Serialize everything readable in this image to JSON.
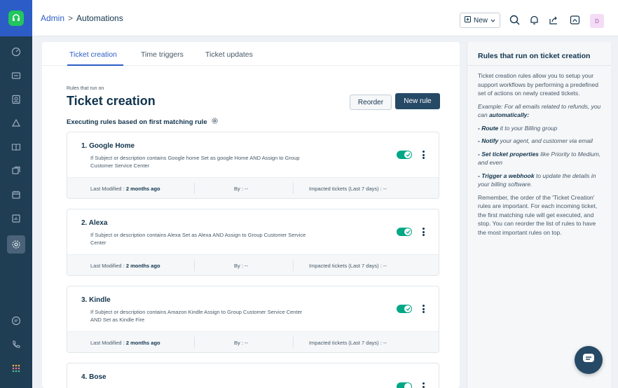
{
  "breadcrumb": {
    "admin": "Admin",
    "separator": ">",
    "current": "Automations"
  },
  "topbar": {
    "new_label": "New",
    "avatar_initial": "D",
    "icons": [
      "search-icon",
      "bell-icon",
      "share-icon",
      "copilot-icon"
    ]
  },
  "tabs": [
    "Ticket creation",
    "Time triggers",
    "Ticket updates"
  ],
  "page": {
    "pre_title": "Rules that run on",
    "title": "Ticket creation",
    "reorder_label": "Reorder",
    "new_rule_label": "New rule",
    "subtitle": "Executing rules based on first matching rule"
  },
  "rules": [
    {
      "name": "1. Google Home",
      "desc_line1": "If Subject or description contains Google home Set as google Home AND Assign to Group",
      "desc_line2": "Customer Service Center",
      "enabled": true,
      "last_modified_label": "Last Modified :",
      "last_modified_value": "2 months ago",
      "by": "By : --",
      "impacted": "Impacted tickets (Last 7 days) : --"
    },
    {
      "name": "2. Alexa",
      "desc_line1": "If Subject or description contains Alexa Set as Alexa AND Assign to Group Customer Service",
      "desc_line2": "Center",
      "enabled": true,
      "last_modified_label": "Last Modified :",
      "last_modified_value": "2 months ago",
      "by": "By : --",
      "impacted": "Impacted tickets (Last 7 days) : --"
    },
    {
      "name": "3. Kindle",
      "desc_line1": "If Subject or description contains Amazon Kindle Assign to Group Customer Service Center",
      "desc_line2": "AND Set as Kindle Fire",
      "enabled": true,
      "last_modified_label": "Last Modified :",
      "last_modified_value": "2 months ago",
      "by": "By : --",
      "impacted": "Impacted tickets (Last 7 days) : --"
    },
    {
      "name": "4. Bose",
      "enabled": true
    }
  ],
  "help": {
    "title": "Rules that run on ticket creation",
    "intro": "Ticket creation rules allow you to setup your support workflows by performing a predefined set of actions on newly created tickets.",
    "example_prefix": "Example: For all emails related to refunds, you can ",
    "example_bold": "automatically:",
    "b1_bold": "- Route",
    "b1_rest": " it to your Billing group",
    "b2_bold": "- Notify",
    "b2_rest": " your agent, and customer via email",
    "b3_bold": "- Set ticket properties",
    "b3_rest": " like Priority to Medium, and even",
    "b4_bold": "- Trigger a webhook",
    "b4_rest": " to update the details in your billing software.",
    "closing": "Remember, the order of the 'Ticket Creation' rules are important. For each incoming ticket, the first matching rule will get executed, and stop. You can reorder the list of rules to have the most important rules on top."
  },
  "colors": {
    "primary": "#2c5cc5",
    "nav_bg": "#1f3d53",
    "toggle_on": "#00a886",
    "button_dark": "#264966"
  }
}
